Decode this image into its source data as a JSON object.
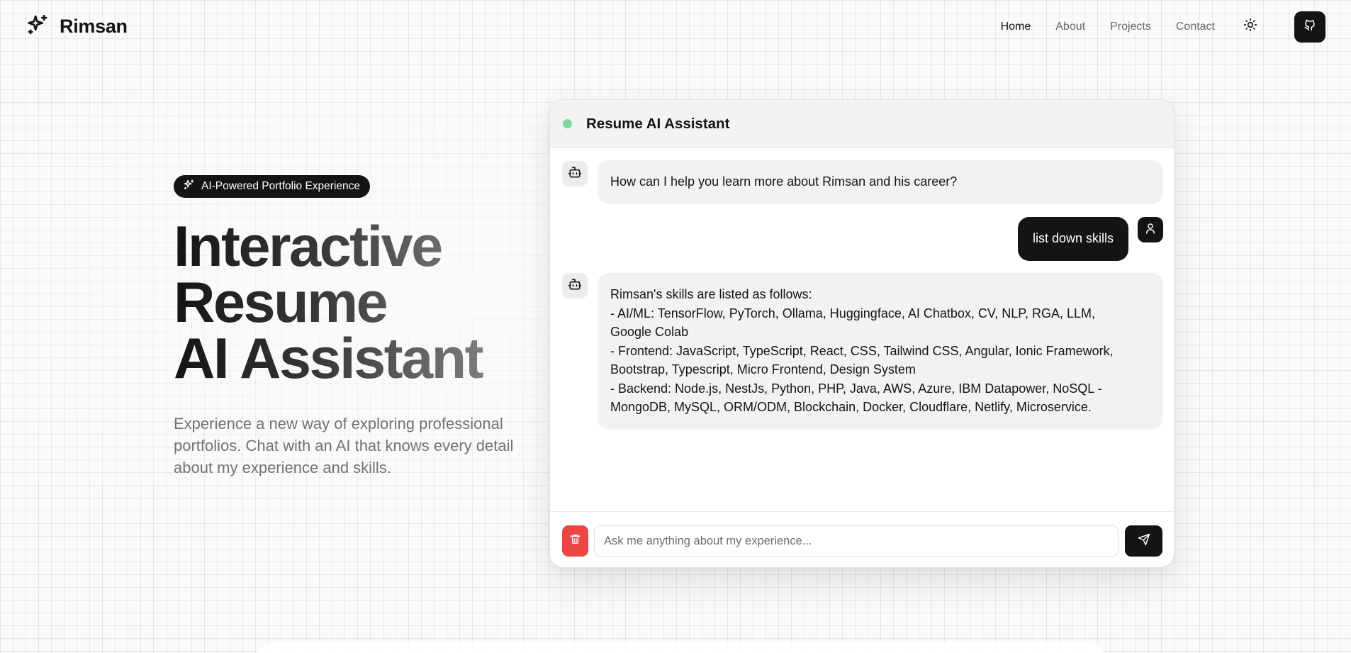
{
  "brand": {
    "name": "Rimsan",
    "logo_icon": "sparkles-icon"
  },
  "nav": {
    "items": [
      {
        "label": "Home",
        "active": true
      },
      {
        "label": "About",
        "active": false
      },
      {
        "label": "Projects",
        "active": false
      },
      {
        "label": "Contact",
        "active": false
      }
    ],
    "theme_icon": "sun-icon",
    "github_icon": "github-icon"
  },
  "hero": {
    "badge": "AI-Powered Portfolio Experience",
    "title_lines": [
      "Interactive",
      "Resume",
      "AI Assistant"
    ],
    "description": "Experience a new way of exploring professional portfolios. Chat with an AI that knows every detail about my experience and skills."
  },
  "chat": {
    "title": "Resume AI Assistant",
    "status_color": "#7dd89f",
    "messages": [
      {
        "role": "bot",
        "lines": [
          "How can I help you learn more about Rimsan and his career?"
        ]
      },
      {
        "role": "user",
        "lines": [
          "list down skills"
        ]
      },
      {
        "role": "bot",
        "lines": [
          "Rimsan's skills are listed as follows:",
          "- AI/ML: TensorFlow, PyTorch, Ollama, Huggingface, AI Chatbox, CV, NLP, RGA, LLM,",
          "Google Colab",
          "- Frontend: JavaScript, TypeScript, React, CSS, Tailwind CSS, Angular, Ionic Framework,",
          "Bootstrap, Typescript, Micro Frontend, Design System",
          "- Backend: Node.js, NestJs, Python, PHP, Java, AWS, Azure, IBM Datapower, NoSQL -",
          "MongoDB, MySQL, ORM/ODM, Blockchain, Docker, Cloudflare, Netlify, Microservice."
        ]
      }
    ],
    "input_placeholder": "Ask me anything about my experience...",
    "input_value": "",
    "clear_icon": "trash-icon",
    "send_icon": "send-icon",
    "clear_color": "#ef4444"
  }
}
